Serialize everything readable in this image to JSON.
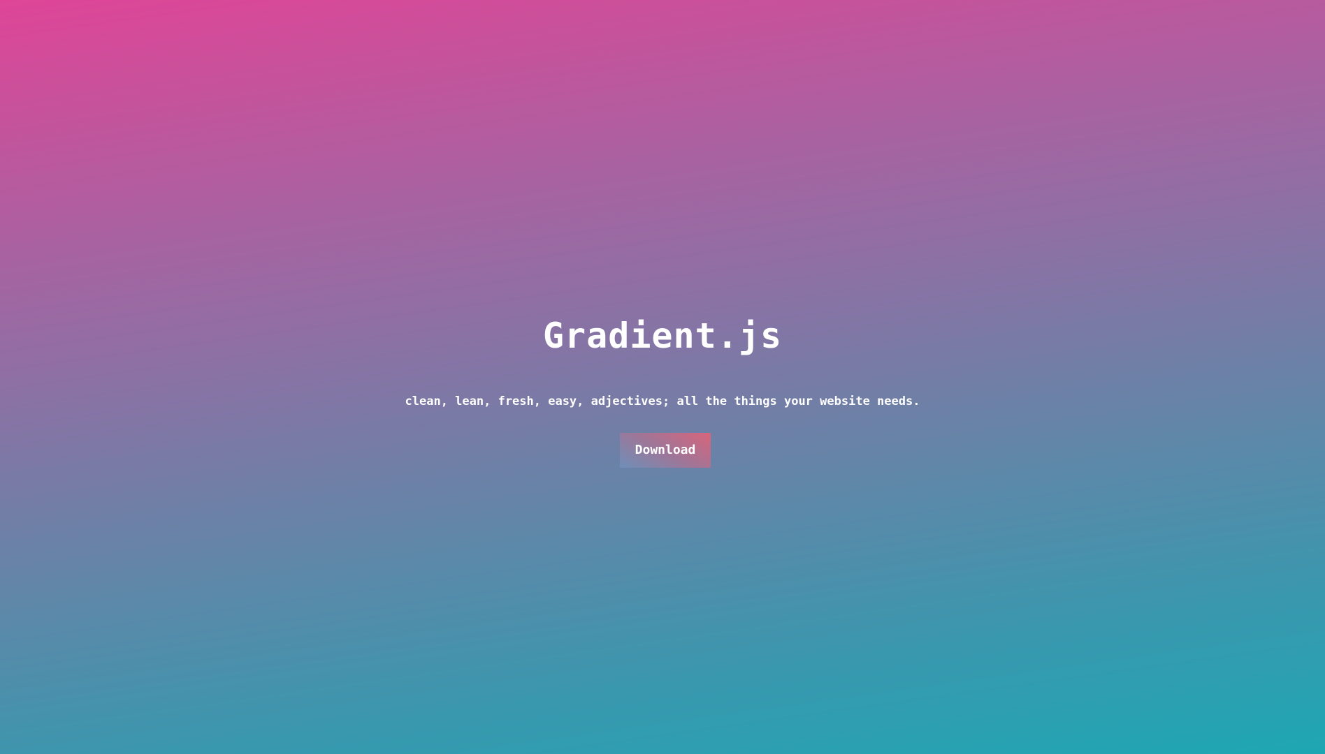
{
  "hero": {
    "title": "Gradient.js",
    "tagline": "clean, lean, fresh, easy, adjectives; all the things your website needs.",
    "download_label": "Download"
  },
  "colors": {
    "background_top": "#df4597",
    "background_middle": "#7f78a5",
    "background_bottom": "#1ea7b3",
    "button_left": "#6f8fb8",
    "button_right": "#d8657c",
    "text": "#ffffff"
  }
}
